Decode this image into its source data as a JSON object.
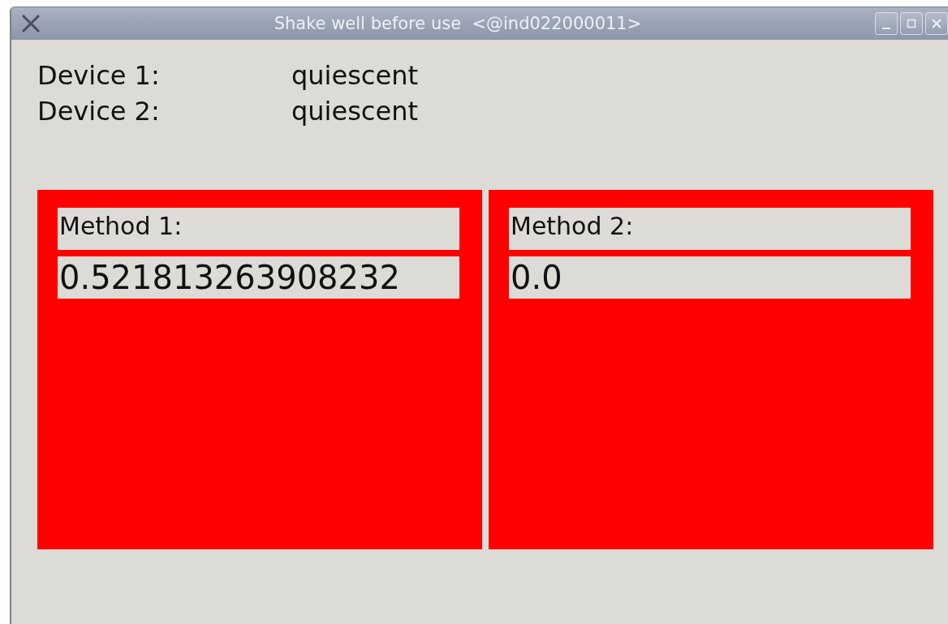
{
  "window": {
    "title": "Shake well before use  <@ind022000011>"
  },
  "devices": [
    {
      "label": "Device 1:",
      "status": "quiescent"
    },
    {
      "label": "Device 2:",
      "status": "quiescent"
    }
  ],
  "methods": [
    {
      "label": "Method 1:",
      "value": "0.521813263908232"
    },
    {
      "label": "Method 2:",
      "value": "0.0"
    }
  ]
}
